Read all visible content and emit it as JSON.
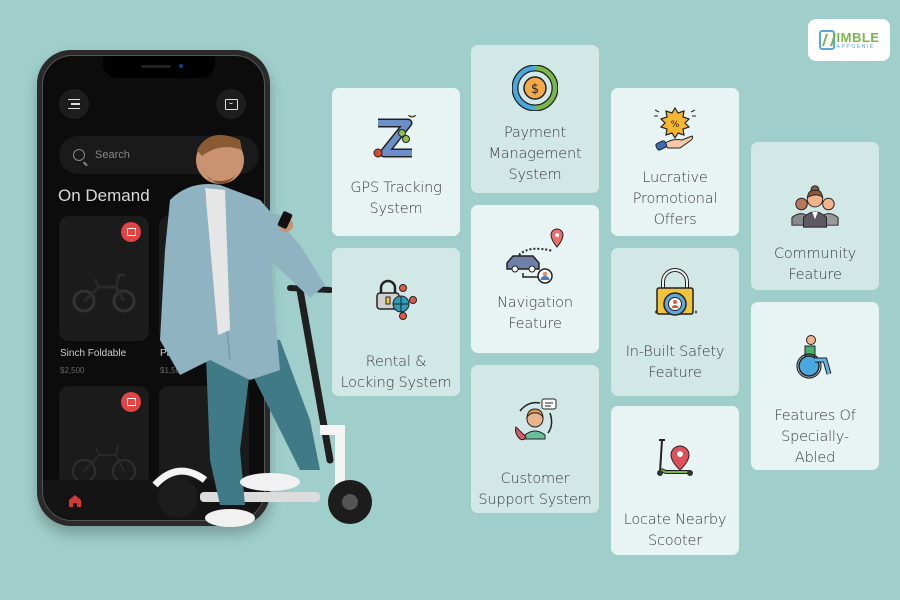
{
  "brand": {
    "logo_main": "IMBLE",
    "logo_sub": "APPGENIE",
    "colors": {
      "background": "#a0cfcb",
      "green": "#7ab648",
      "blue": "#5aa7d6",
      "card_light": "#e8f4f3",
      "card_tint": "#d2e8e7"
    }
  },
  "phone": {
    "search_placeholder": "Search",
    "section_title": "On Demand",
    "products": [
      {
        "name": "Sinch Foldable",
        "price": "$2,500"
      },
      {
        "name": "Pac",
        "price": "$1,50"
      },
      {
        "name": "",
        "price": ""
      },
      {
        "name": "",
        "price": ""
      }
    ],
    "nav": {
      "home_icon": "home-icon"
    }
  },
  "features": [
    {
      "label": "GPS Tracking\nSystem",
      "icon": "gps-route-icon"
    },
    {
      "label": "Rental &\nLocking System",
      "icon": "lock-network-icon"
    },
    {
      "label": "Payment\nManagement\nSystem",
      "icon": "payment-cycle-icon"
    },
    {
      "label": "Navigation\nFeature",
      "icon": "car-navigation-icon"
    },
    {
      "label": "Customer\nSupport System",
      "icon": "customer-support-icon"
    },
    {
      "label": "Lucrative\nPromotional\nOffers",
      "icon": "discount-hand-icon"
    },
    {
      "label": "In-Built Safety\nFeature",
      "icon": "safety-lock-icon"
    },
    {
      "label": "Locate Nearby\nScooter",
      "icon": "scooter-location-icon"
    },
    {
      "label": "Community\nFeature",
      "icon": "community-icon"
    },
    {
      "label": "Features Of\nSpecially-\nAbled",
      "icon": "wheelchair-icon"
    }
  ]
}
